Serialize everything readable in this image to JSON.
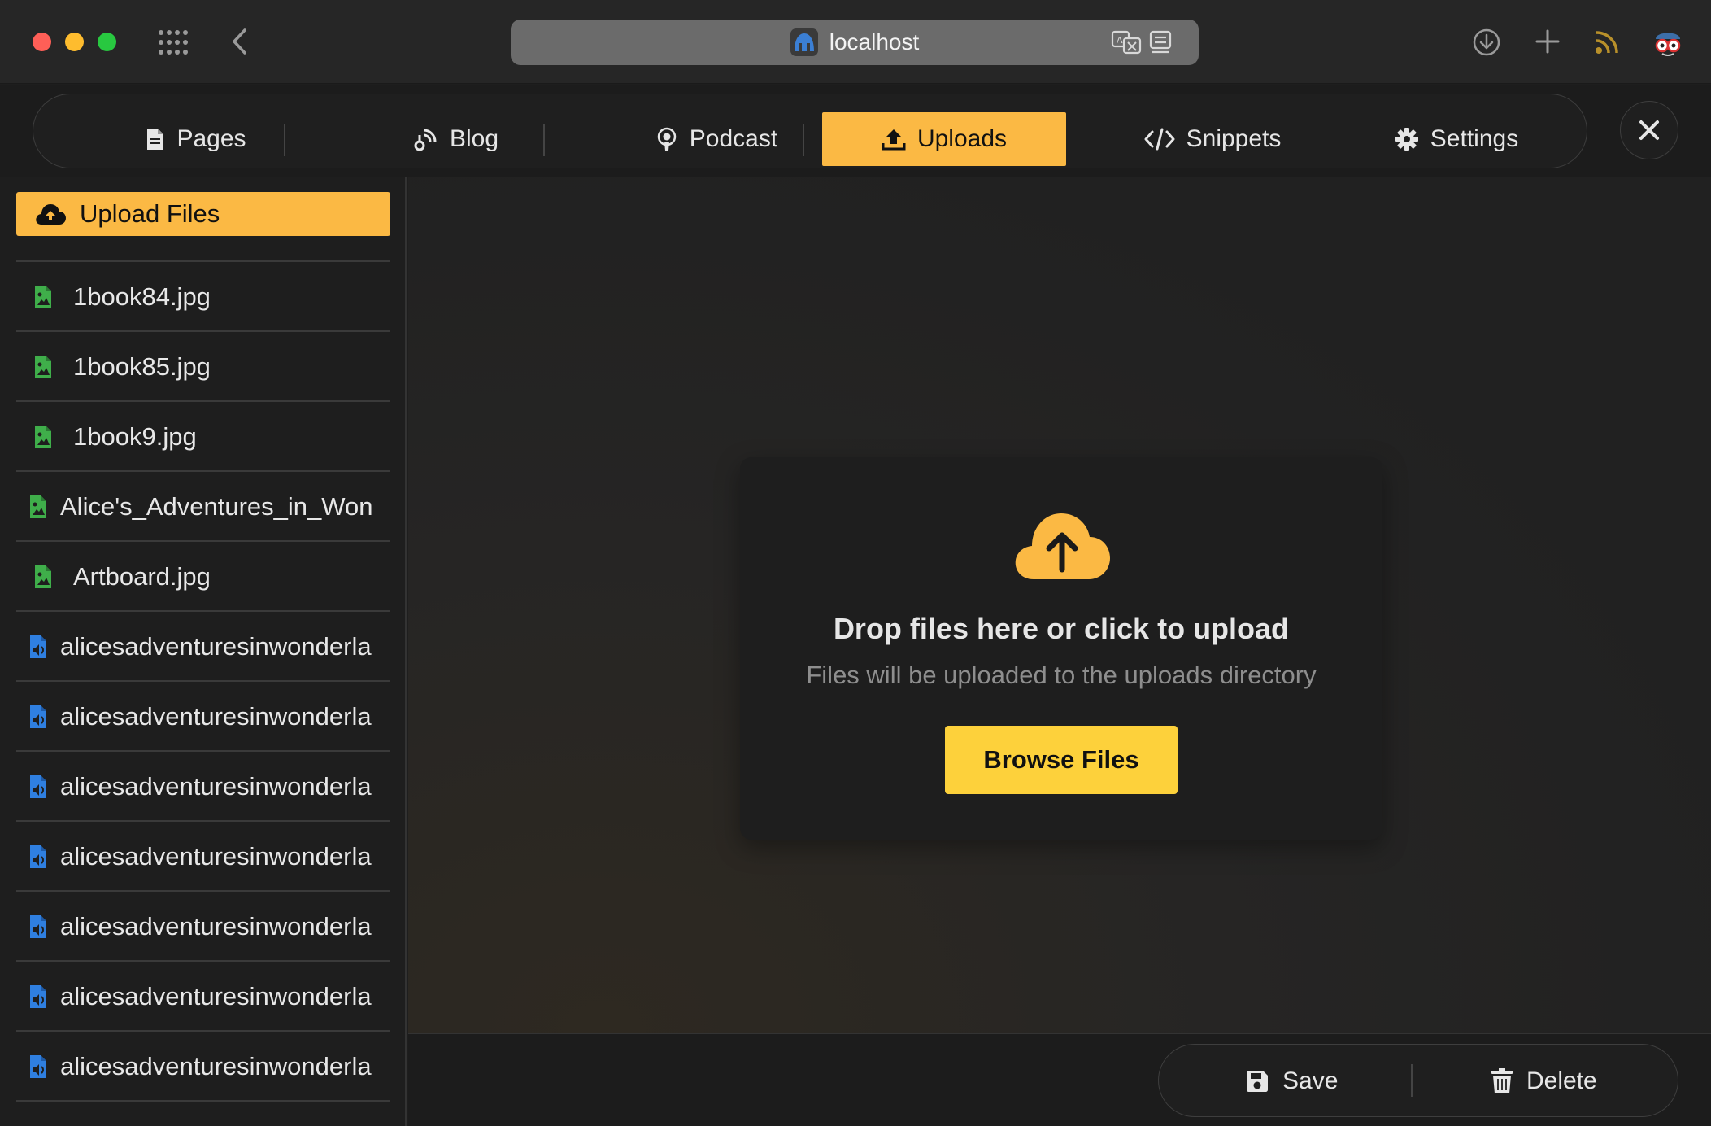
{
  "browser": {
    "url": "localhost",
    "icons": [
      "apps-grid-icon",
      "back-chevron-icon",
      "translate-icon",
      "reader-view-icon",
      "download-icon",
      "new-tab-plus-icon",
      "rss-icon",
      "extension-mascot-icon"
    ],
    "traffic_lights": {
      "close": "#fe5f57",
      "minimize": "#febc2e",
      "zoom": "#28c840"
    }
  },
  "nav": {
    "tabs": [
      {
        "label": "Pages",
        "icon": "file-icon",
        "active": false
      },
      {
        "label": "Blog",
        "icon": "broadcast-icon",
        "active": false
      },
      {
        "label": "Podcast",
        "icon": "podcast-icon",
        "active": false
      },
      {
        "label": "Uploads",
        "icon": "upload-icon",
        "active": true
      },
      {
        "label": "Snippets",
        "icon": "code-icon",
        "active": false
      },
      {
        "label": "Settings",
        "icon": "gear-icon",
        "active": false
      }
    ],
    "close_icon": "close-x-icon"
  },
  "sidebar": {
    "upload_label": "Upload Files",
    "files": [
      {
        "name": "1book84.jpg",
        "type": "image"
      },
      {
        "name": "1book85.jpg",
        "type": "image"
      },
      {
        "name": "1book9.jpg",
        "type": "image"
      },
      {
        "name": "Alice's_Adventures_in_Won",
        "type": "image"
      },
      {
        "name": "Artboard.jpg",
        "type": "image"
      },
      {
        "name": "alicesadventuresinwonderla",
        "type": "audio"
      },
      {
        "name": "alicesadventuresinwonderla",
        "type": "audio"
      },
      {
        "name": "alicesadventuresinwonderla",
        "type": "audio"
      },
      {
        "name": "alicesadventuresinwonderla",
        "type": "audio"
      },
      {
        "name": "alicesadventuresinwonderla",
        "type": "audio"
      },
      {
        "name": "alicesadventuresinwonderla",
        "type": "audio"
      },
      {
        "name": "alicesadventuresinwonderla",
        "type": "audio"
      }
    ]
  },
  "dropzone": {
    "title": "Drop files here or click to upload",
    "subtitle": "Files will be uploaded to the uploads directory",
    "button_label": "Browse Files",
    "icon": "cloud-upload-icon"
  },
  "footer": {
    "save_label": "Save",
    "delete_label": "Delete"
  },
  "colors": {
    "accent": "#fbb944",
    "browse_button": "#fdd13b",
    "image_file_icon": "#3fae4a",
    "audio_file_icon": "#2f7fe0"
  }
}
